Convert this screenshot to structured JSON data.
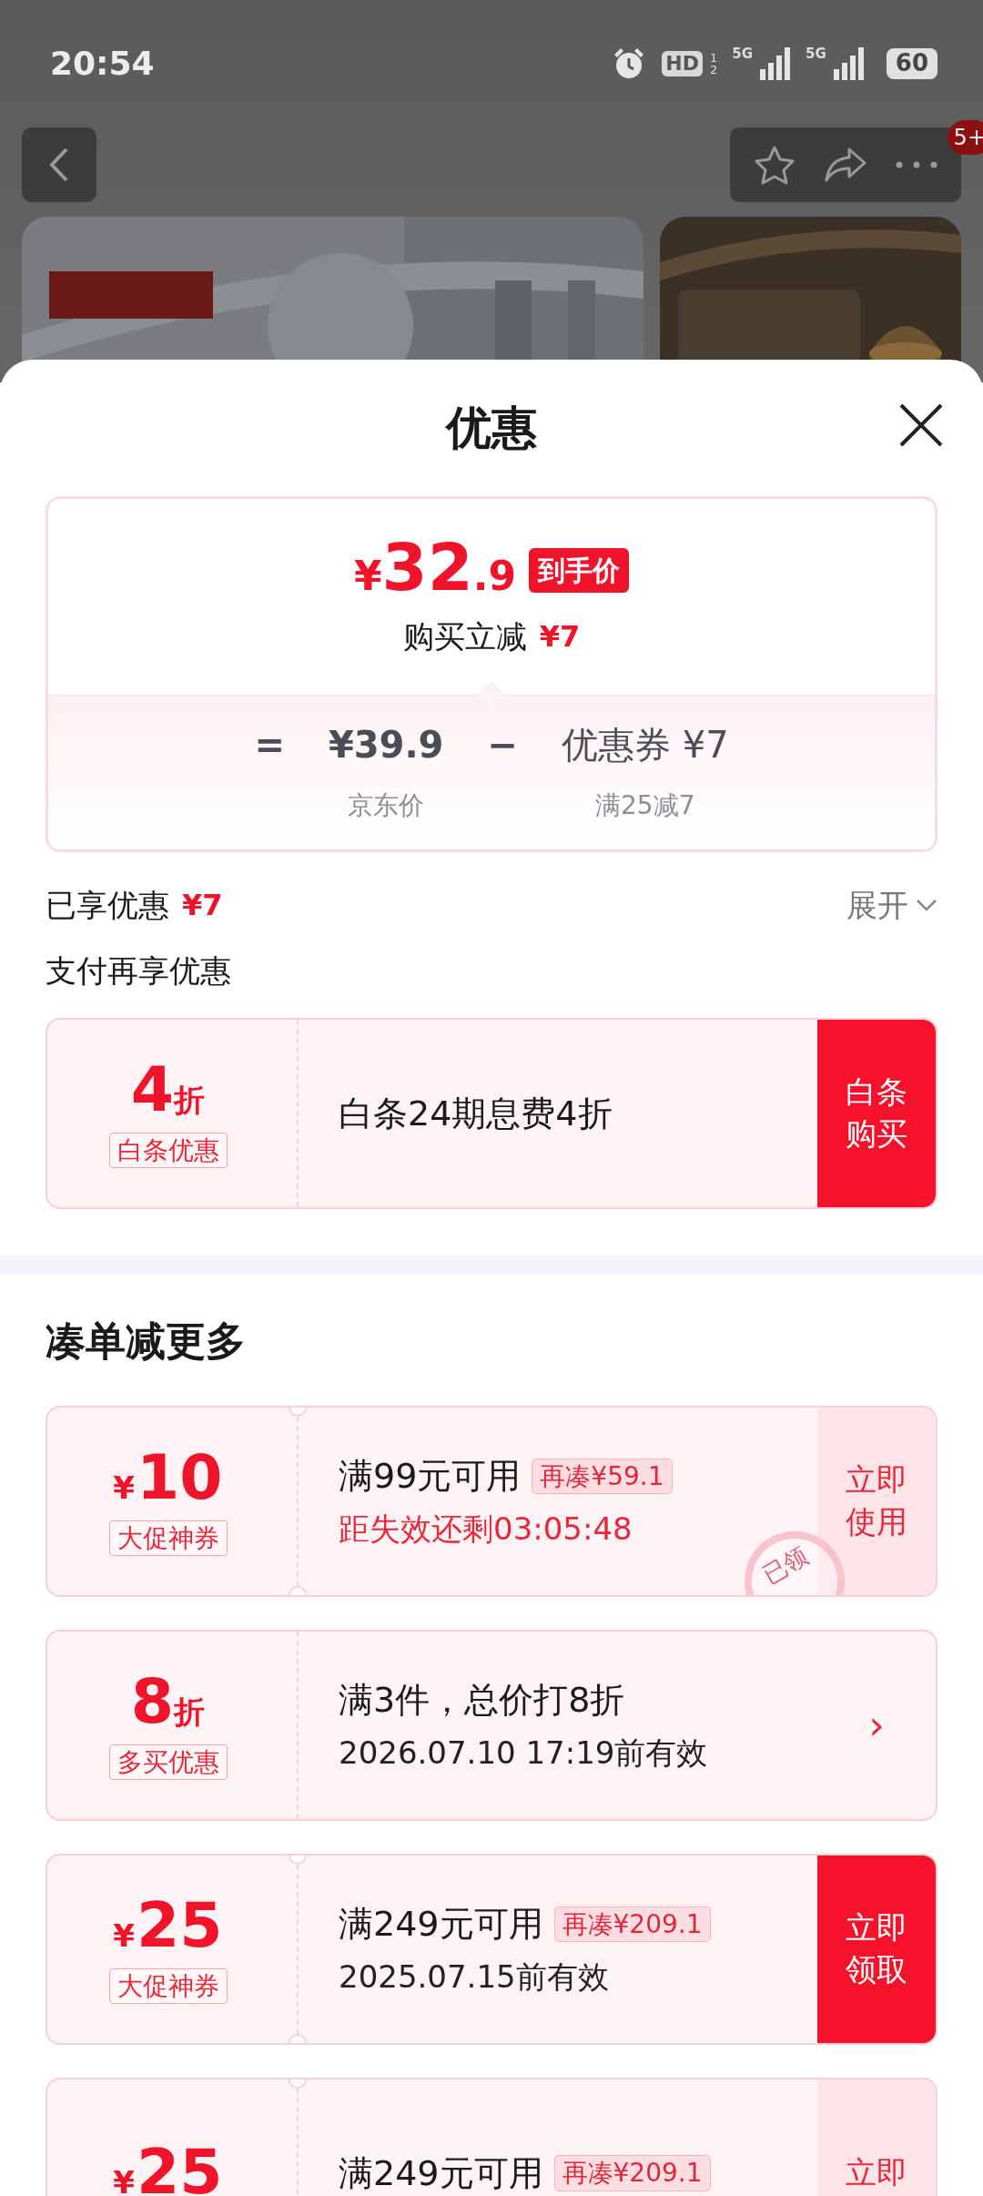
{
  "status_bar": {
    "time": "20:54",
    "hd": "HD",
    "hd_sims": [
      "1",
      "2"
    ],
    "networks": [
      "5G",
      "5G"
    ],
    "battery": "60"
  },
  "backdrop": {
    "notification_badge": "5+"
  },
  "sheet": {
    "title": "优惠"
  },
  "price_card": {
    "currency": "¥",
    "price_integer": "32",
    "price_decimal": ".9",
    "price_tag": "到手价",
    "saving_label": "购买立减",
    "saving_amount": "¥7",
    "breakdown": {
      "equals": "=",
      "base_price": "¥39.9",
      "base_label": "京东价",
      "minus": "−",
      "coupon_name": "优惠券",
      "coupon_amount": "¥7",
      "coupon_label": "满25减7"
    }
  },
  "enjoyed": {
    "label": "已享优惠",
    "amount": "¥7",
    "toggle": "展开",
    "expanded": false
  },
  "payment_section": {
    "title": "支付再享优惠",
    "offers": [
      {
        "amount": "4",
        "unit": "折",
        "tag": "白条优惠",
        "title": "白条24期息费4折",
        "action": "白条购买",
        "kind": "filled",
        "notched": false
      }
    ]
  },
  "more_section": {
    "title": "凑单减更多",
    "coupons": [
      {
        "currency": "¥",
        "amount": "10",
        "tag": "大促神券",
        "title": "满99元可用",
        "extra": "再凑¥59.1",
        "subtitle": "距失效还剩03:05:48",
        "subtitle_urgent": true,
        "action": "立即使用",
        "kind": "light",
        "stamp": "已领",
        "notched": true
      },
      {
        "amount": "8",
        "unit": "折",
        "tag": "多买优惠",
        "title": "满3件，总价打8折",
        "subtitle": "2026.07.10 17:19前有效",
        "subtitle_urgent": false,
        "action": "›",
        "kind": "arrow",
        "notched": false
      },
      {
        "currency": "¥",
        "amount": "25",
        "tag": "大促神券",
        "title": "满249元可用",
        "extra": "再凑¥209.1",
        "subtitle": "2025.07.15前有效",
        "subtitle_urgent": false,
        "action": "立即领取",
        "kind": "filled",
        "notched": true
      },
      {
        "currency": "¥",
        "amount": "25",
        "title": "满249元可用",
        "extra": "再凑¥209.1",
        "action": "立即",
        "kind": "light",
        "notched": true
      }
    ]
  }
}
